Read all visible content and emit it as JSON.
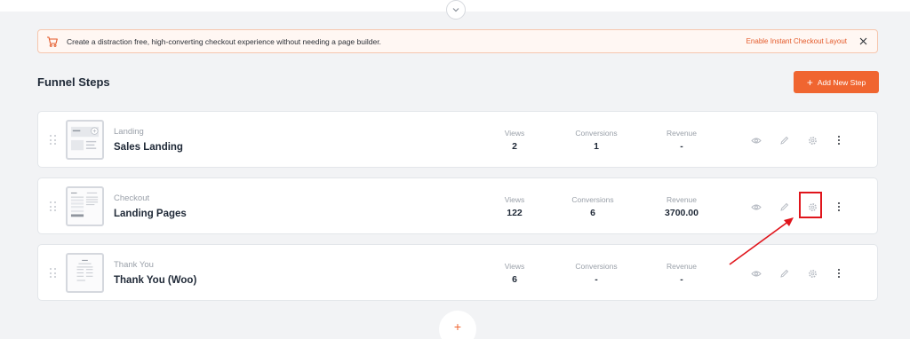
{
  "notice": {
    "text": "Create a distraction free, high-converting checkout experience without needing a page builder.",
    "link": "Enable Instant Checkout Layout"
  },
  "page": {
    "title": "Funnel Steps",
    "add_button_label": "Add New Step",
    "add_button_icon": "+",
    "bottom_add_icon": "+"
  },
  "steps": [
    {
      "type": "Landing",
      "name": "Sales Landing",
      "views_label": "Views",
      "views": "2",
      "conversions_label": "Conversions",
      "conversions": "1",
      "revenue_label": "Revenue",
      "revenue": "-"
    },
    {
      "type": "Checkout",
      "name": "Landing Pages",
      "views_label": "Views",
      "views": "122",
      "conversions_label": "Conversions",
      "conversions": "6",
      "revenue_label": "Revenue",
      "revenue": "3700.00"
    },
    {
      "type": "Thank You",
      "name": "Thank You (Woo)",
      "views_label": "Views",
      "views": "6",
      "conversions_label": "Conversions",
      "conversions": "-",
      "revenue_label": "Revenue",
      "revenue": "-"
    }
  ],
  "colors": {
    "accent": "#f06530",
    "annotation": "#e0151c",
    "notice_bg": "#fff7f3"
  },
  "icons": [
    "chevron-down-icon",
    "cart-icon",
    "close-icon",
    "drag-handle-icon",
    "eye-icon",
    "pencil-icon",
    "gear-icon",
    "more-vertical-icon",
    "plus-icon"
  ]
}
